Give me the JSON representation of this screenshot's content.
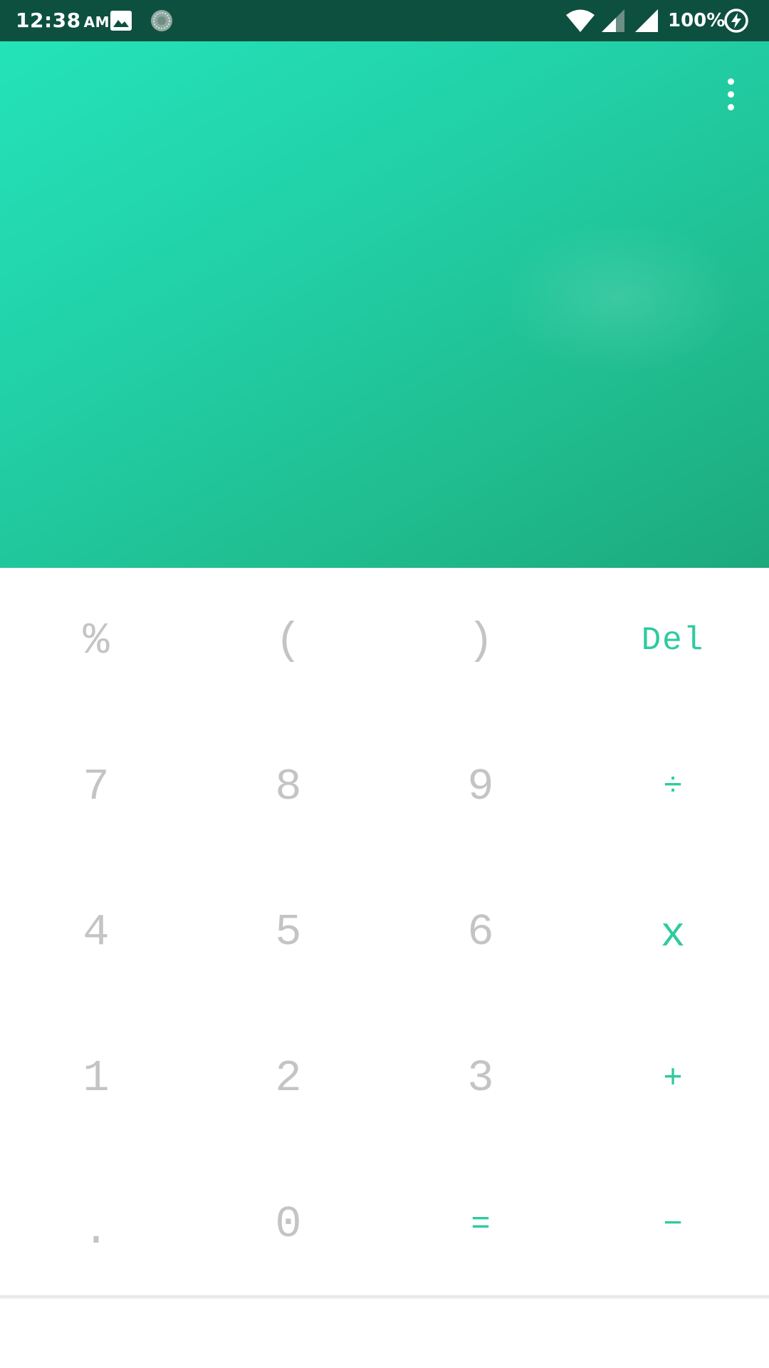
{
  "status_bar": {
    "time": "12:38",
    "ampm": "AM",
    "battery": "100%",
    "icons": [
      "image-notification-icon",
      "sync-notification-icon",
      "wifi-icon",
      "signal-icon",
      "signal-full-icon",
      "battery-charging-icon"
    ]
  },
  "display": {
    "expression": "",
    "result": "",
    "menu_icon": "more-vert-icon"
  },
  "keypad": {
    "rows": [
      [
        "%",
        "(",
        ")",
        "Del"
      ],
      [
        "7",
        "8",
        "9",
        "÷"
      ],
      [
        "4",
        "5",
        "6",
        "x"
      ],
      [
        "1",
        "2",
        "3",
        "+"
      ],
      [
        ".",
        "0",
        "=",
        "−"
      ]
    ]
  },
  "colors": {
    "status_bar": "#0e5040",
    "display_gradient_start": "#24e3b9",
    "display_gradient_end": "#1ca97c",
    "digit_text": "#c4c4c4",
    "operator_text": "#2ecaa0",
    "keypad_background": "#ffffff"
  }
}
